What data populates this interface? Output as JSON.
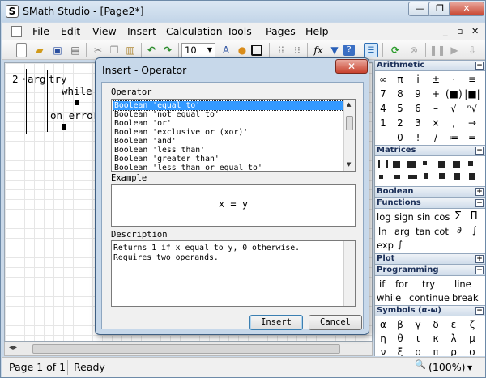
{
  "window": {
    "title": "SMath Studio - [Page2*]",
    "minimize": "—",
    "restore": "❐",
    "close": "✕"
  },
  "menu": [
    "File",
    "Edit",
    "View",
    "Insert",
    "Calculation",
    "Tools",
    "Pages",
    "Help"
  ],
  "mdi_controls": [
    "_",
    "▫",
    "✕"
  ],
  "toolbar": {
    "zoom": "10"
  },
  "worksheet": {
    "line_number": "2",
    "arg": "arg",
    "try": "try",
    "while": "while",
    "on_error": "on error"
  },
  "dialog": {
    "title": "Insert - Operator",
    "close": "✕",
    "operator_label": "Operator",
    "operators": [
      "Boolean 'equal to'",
      "Boolean 'not equal to'",
      "Boolean 'or'",
      "Boolean 'exclusive or (xor)'",
      "Boolean 'and'",
      "Boolean 'less than'",
      "Boolean 'greater than'",
      "Boolean 'less than or equal to'"
    ],
    "example_label": "Example",
    "example": "x = y",
    "description_label": "Description",
    "description": [
      "Returns 1 if x equal to y, 0 otherwise.",
      "Requires two operands."
    ],
    "insert_button": "Insert",
    "cancel_button": "Cancel"
  },
  "panels": {
    "arithmetic": {
      "title": "Arithmetic",
      "rows": [
        [
          "∞",
          "π",
          "i",
          "±",
          "⋅",
          "≡"
        ],
        [
          "7",
          "8",
          "9",
          "+",
          "(■)",
          "|■|"
        ],
        [
          "4",
          "5",
          "6",
          "–",
          "√",
          "ⁿ√"
        ],
        [
          "1",
          "2",
          "3",
          "×",
          ",",
          "→"
        ],
        [
          "",
          "0",
          "!",
          "/",
          "≔",
          "="
        ]
      ]
    },
    "matrices": {
      "title": "Matrices"
    },
    "boolean": {
      "title": "Boolean"
    },
    "functions": {
      "title": "Functions",
      "row1": [
        "log",
        "sign",
        "sin",
        "cos"
      ],
      "row2": [
        "ln",
        "arg",
        "tan",
        "cot"
      ],
      "row3": [
        "exp"
      ]
    },
    "plot": {
      "title": "Plot"
    },
    "programming": {
      "title": "Programming",
      "row1": [
        "if",
        "for",
        "try",
        "line"
      ],
      "row2": [
        "while",
        "continue",
        "break"
      ]
    },
    "symbols": {
      "title": "Symbols (α-ω)",
      "row1": [
        "α",
        "β",
        "γ",
        "δ",
        "ε",
        "ζ"
      ],
      "row2": [
        "η",
        "θ",
        "ι",
        "κ",
        "λ",
        "μ"
      ],
      "row3": [
        "ν",
        "ξ",
        "ο",
        "π",
        "ρ",
        "σ"
      ]
    }
  },
  "status": {
    "page": "Page 1 of 1",
    "state": "Ready",
    "zoom": "(100%)"
  }
}
